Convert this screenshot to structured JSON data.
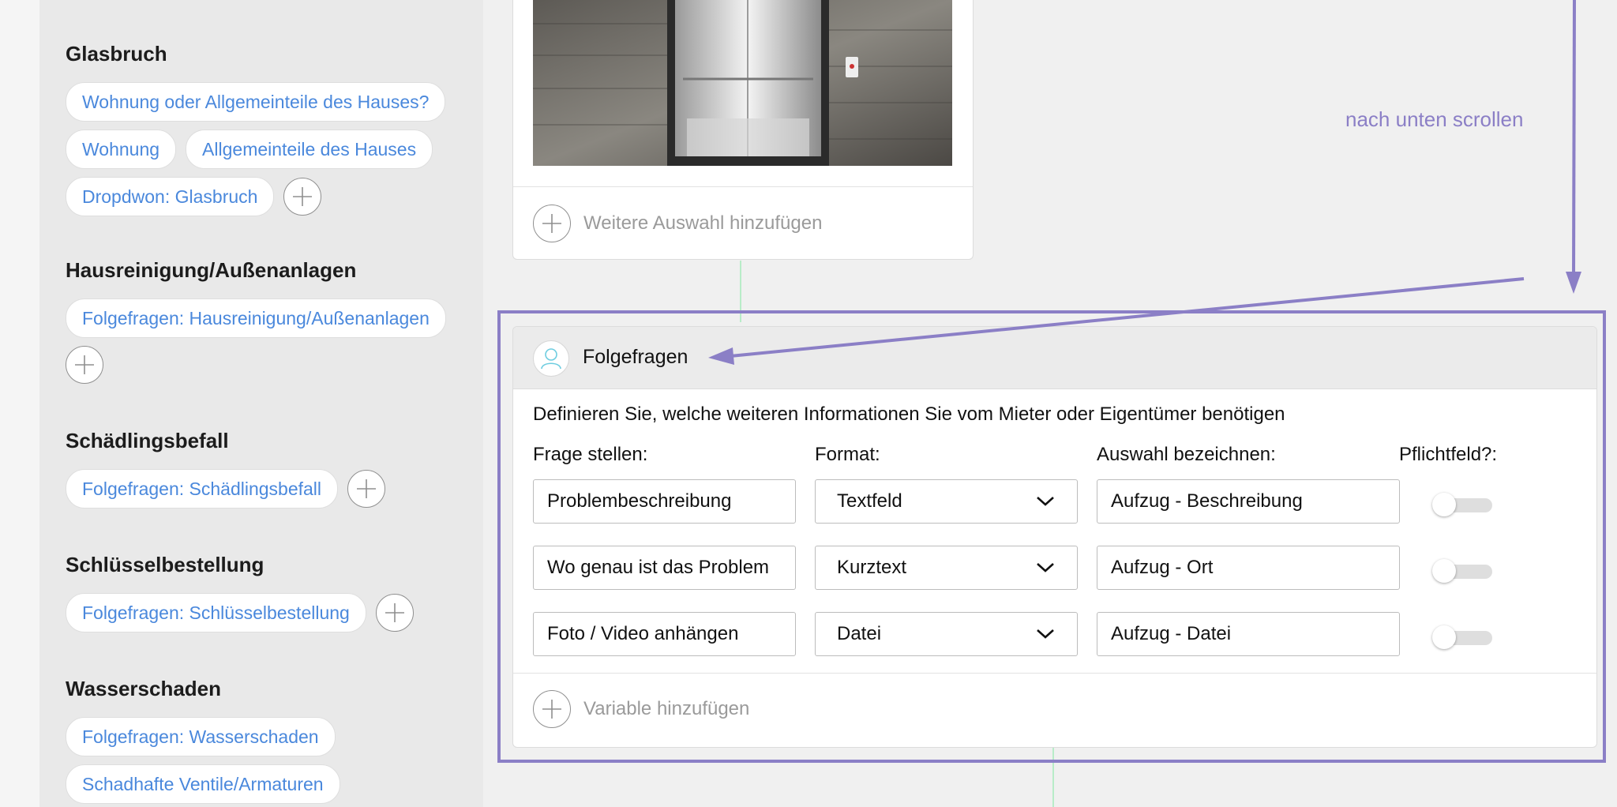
{
  "sidebar": {
    "groups": [
      {
        "title": "Glasbruch",
        "chips": [
          "Wohnung oder Allgemeinteile des Hauses?",
          "Wohnung",
          "Allgemeinteile des Hauses",
          "Dropdwon: Glasbruch"
        ]
      },
      {
        "title": "Hausreinigung/Außenanlagen",
        "chips": [
          "Folgefragen: Hausreinigung/Außenanlagen"
        ]
      },
      {
        "title": "Schädlingsbefall",
        "chips": [
          "Folgefragen: Schädlingsbefall"
        ]
      },
      {
        "title": "Schlüsselbestellung",
        "chips": [
          "Folgefragen: Schlüsselbestellung"
        ]
      },
      {
        "title": "Wasserschaden",
        "chips": [
          "Folgefragen: Wasserschaden",
          "Schadhafte Ventile/Armaturen"
        ]
      }
    ]
  },
  "image_card": {
    "add_label": "Weitere Auswahl hinzufügen"
  },
  "followup": {
    "title": "Folgefragen",
    "description": "Definieren Sie, welche weiteren Informationen Sie vom Mieter oder Eigentümer benötigen",
    "headers": {
      "question": "Frage stellen:",
      "format": "Format:",
      "label": "Auswahl bezeichnen:",
      "required": "Pflichtfeld?:"
    },
    "rows": [
      {
        "question": "Problembeschreibung",
        "format": "Textfeld",
        "label": "Aufzug - Beschreibung",
        "required": false
      },
      {
        "question": "Wo genau ist das Problem",
        "format": "Kurztext",
        "label": "Aufzug - Ort",
        "required": false
      },
      {
        "question": "Foto / Video anhängen",
        "format": "Datei",
        "label": "Aufzug - Datei",
        "required": false
      }
    ],
    "add_label": "Variable hinzufügen"
  },
  "annotation": {
    "text": "nach unten scrollen",
    "color": "#8b7fc6"
  },
  "colors": {
    "chip_text": "#4a88dc",
    "highlight": "#8b7fc6",
    "connector": "#b8ecc8"
  }
}
